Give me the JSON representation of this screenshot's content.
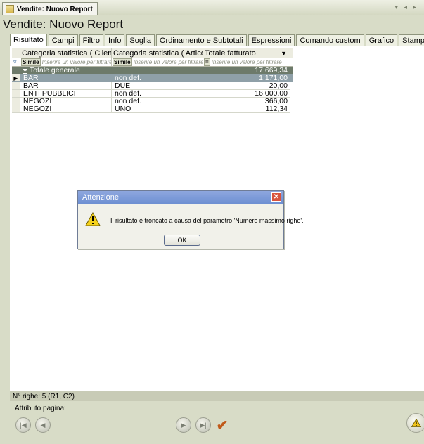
{
  "doc_tab": {
    "title": "Vendite: Nuovo Report"
  },
  "window": {
    "title": "Vendite: Nuovo Report"
  },
  "tabs": [
    {
      "label": "Risultato",
      "active": true
    },
    {
      "label": "Campi"
    },
    {
      "label": "Filtro"
    },
    {
      "label": "Info"
    },
    {
      "label": "Soglia"
    },
    {
      "label": "Ordinamento e Subtotali"
    },
    {
      "label": "Espressioni"
    },
    {
      "label": "Comando custom"
    },
    {
      "label": "Grafico"
    },
    {
      "label": "Stampa"
    }
  ],
  "grid": {
    "columns": [
      "Categoria statistica ( Cliente",
      "Categoria statistica ( Articolo )",
      "Totale fatturato"
    ],
    "filters": [
      {
        "badge": "Simile",
        "placeholder": "Inserire un valore per filtrare"
      },
      {
        "badge": "Simile",
        "placeholder": "Inserire un valore per filtrare"
      },
      {
        "badge": "=",
        "placeholder": "Inserire un valore per filtrare"
      }
    ],
    "total": {
      "label": "Totale generale",
      "value": "17.669,34"
    },
    "rows": [
      [
        "BAR",
        "non def.",
        "1.171,00"
      ],
      [
        "BAR",
        "DUE",
        "20,00"
      ],
      [
        "ENTI PUBBLICI",
        "non def.",
        "16.000,00"
      ],
      [
        "NEGOZI",
        "non def.",
        "366,00"
      ],
      [
        "NEGOZI",
        "UNO",
        "112,34"
      ]
    ]
  },
  "dialog": {
    "title": "Attenzione",
    "close": "✕",
    "message": "Il risultato è troncato a causa del parametro 'Numero massimo righe'.",
    "ok": "OK"
  },
  "status": {
    "text": "N° righe: 5  (R1, C2)"
  },
  "footer": {
    "page_attr_label": "Attributo pagina:"
  },
  "icons": {
    "first": "first-page-icon",
    "prev": "prev-page-icon",
    "next": "next-page-icon",
    "last": "last-page-icon",
    "confirm": "checkmark-icon",
    "warning": "warning-icon"
  }
}
